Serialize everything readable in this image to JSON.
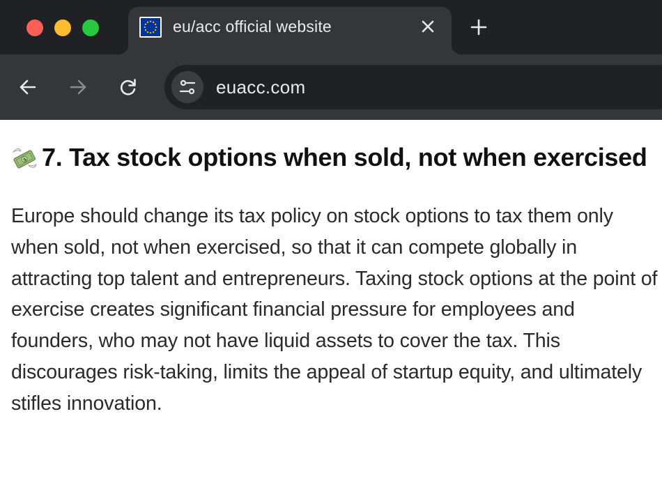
{
  "browser": {
    "tab": {
      "title": "eu/acc official website",
      "favicon": "eu-flag-icon"
    },
    "new_tab_icon": "plus-icon",
    "nav": {
      "back_icon": "arrow-left-icon",
      "forward_icon": "arrow-right-icon",
      "reload_icon": "reload-icon"
    },
    "address_bar": {
      "url": "euacc.com",
      "site_info_icon": "tune-icon"
    }
  },
  "article": {
    "emoji": "money-with-wings-icon",
    "heading": "7. Tax stock options when sold, not when exercised",
    "body": "Europe should change its tax policy on stock options to tax them only when sold, not when exercised, so that it can compete globally in attracting top talent and entrepreneurs. Taxing stock options at the point of exercise creates significant financial pressure for employees and founders, who may not have liquid assets to cover the tax. This discourages risk-taking, limits the appeal of startup equity, and ultimately stifles innovation."
  },
  "colors": {
    "traffic_close": "#ff5f57",
    "traffic_minimize": "#febc2e",
    "traffic_maximize": "#28c840",
    "chrome_dark": "#202124",
    "chrome_tab": "#35363a",
    "eu_blue": "#003399",
    "eu_gold": "#ffcc00"
  }
}
